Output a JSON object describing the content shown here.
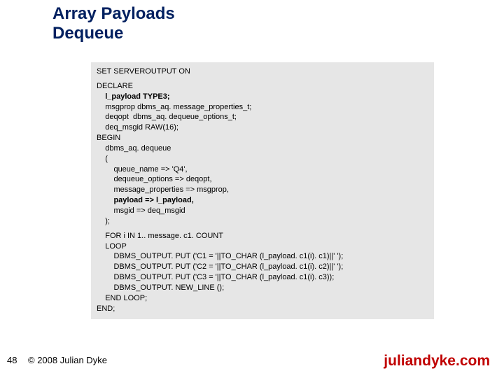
{
  "title": "Array Payloads\nDequeue",
  "code": {
    "l1": "SET SERVEROUTPUT ON",
    "l2": "DECLARE",
    "l3": "    l_payload TYPE3;",
    "l4": "    msgprop dbms_aq. message_properties_t;",
    "l5": "    deqopt  dbms_aq. dequeue_options_t;",
    "l6": "    deq_msgid RAW(16);",
    "l7": "BEGIN",
    "l8": "    dbms_aq. dequeue",
    "l9": "    (",
    "l10": "        queue_name => 'Q4',",
    "l11": "        dequeue_options => deqopt,",
    "l12": "        message_properties => msgprop,",
    "l13": "        payload => l_payload,",
    "l14": "        msgid => deq_msgid",
    "l15": "    );",
    "l16": "    FOR i IN 1.. message. c1. COUNT",
    "l17": "    LOOP",
    "l18": "        DBMS_OUTPUT. PUT ('C1 = '||TO_CHAR (l_payload. c1(i). c1)||' ');",
    "l19": "        DBMS_OUTPUT. PUT ('C2 = '||TO_CHAR (l_payload. c1(i). c2)||' ');",
    "l20": "        DBMS_OUTPUT. PUT ('C3 = '||TO_CHAR (l_payload. c1(i). c3));",
    "l21": "        DBMS_OUTPUT. NEW_LINE ();",
    "l22": "    END LOOP;",
    "l23": "END;"
  },
  "pageNumber": "48",
  "copyright": "© 2008 Julian Dyke",
  "site": "juliandyke.com"
}
